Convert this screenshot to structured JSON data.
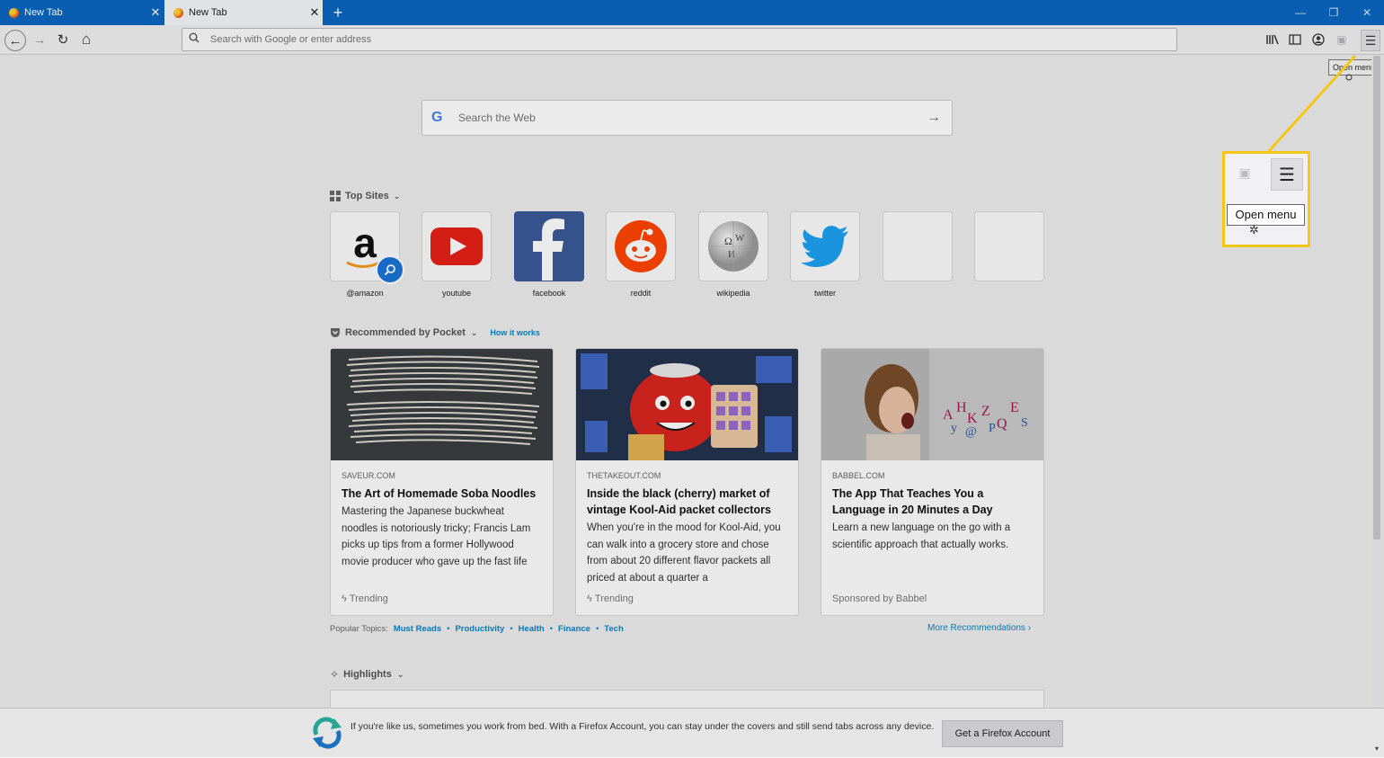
{
  "tabs": [
    {
      "title": "New Tab",
      "active": false
    },
    {
      "title": "New Tab",
      "active": true
    }
  ],
  "window_controls": {
    "minimize": "—",
    "restore": "❐",
    "close": "✕"
  },
  "navbar": {
    "back_icon": "←",
    "forward_icon": "→",
    "reload_icon": "↻",
    "home_icon": "⌂",
    "url_placeholder": "Search with Google or enter address",
    "menu_icon": "☰",
    "tooltip": "Open menu"
  },
  "search": {
    "placeholder": "Search the Web",
    "engine_glyph": "G",
    "submit_icon": "→"
  },
  "top_sites": {
    "title": "Top Sites",
    "sites": [
      {
        "label": "@amazon"
      },
      {
        "label": "youtube"
      },
      {
        "label": "facebook"
      },
      {
        "label": "reddit"
      },
      {
        "label": "wikipedia"
      },
      {
        "label": "twitter"
      },
      {
        "label": ""
      },
      {
        "label": ""
      }
    ]
  },
  "pocket": {
    "title": "Recommended by Pocket",
    "how_it_works": "How it works",
    "cards": [
      {
        "source": "SAVEUR.COM",
        "title": "The Art of Homemade Soba Noodles",
        "desc": "Mastering the Japanese buckwheat noodles is notoriously tricky; Francis Lam picks up tips from a former Hollywood movie producer who gave up the fast life",
        "context": "Trending"
      },
      {
        "source": "THETAKEOUT.COM",
        "title": "Inside the black (cherry) market of vintage Kool-Aid packet collectors",
        "desc": "When you're in the mood for Kool-Aid, you can walk into a grocery store and chose from about 20 different flavor packets all priced at about a quarter a",
        "context": "Trending"
      },
      {
        "source": "BABBEL.COM",
        "title": "The App That Teaches You a Language in 20 Minutes a Day",
        "desc": "Learn a new language on the go with a scientific approach that actually works.",
        "context": "Sponsored by Babbel"
      }
    ],
    "popular_topics_label": "Popular Topics:",
    "topics": [
      "Must Reads",
      "Productivity",
      "Health",
      "Finance",
      "Tech"
    ],
    "more_recommendations": "More Recommendations"
  },
  "highlights": {
    "title": "Highlights"
  },
  "bottom_bar": {
    "text": "If you're like us, sometimes you work from bed. With a Firefox Account, you can stay under the covers and still send tabs across any device.",
    "button": "Get a Firefox Account"
  },
  "callout": {
    "tooltip": "Open menu",
    "menu_icon": "☰",
    "highlight_color": "#f5c518"
  }
}
